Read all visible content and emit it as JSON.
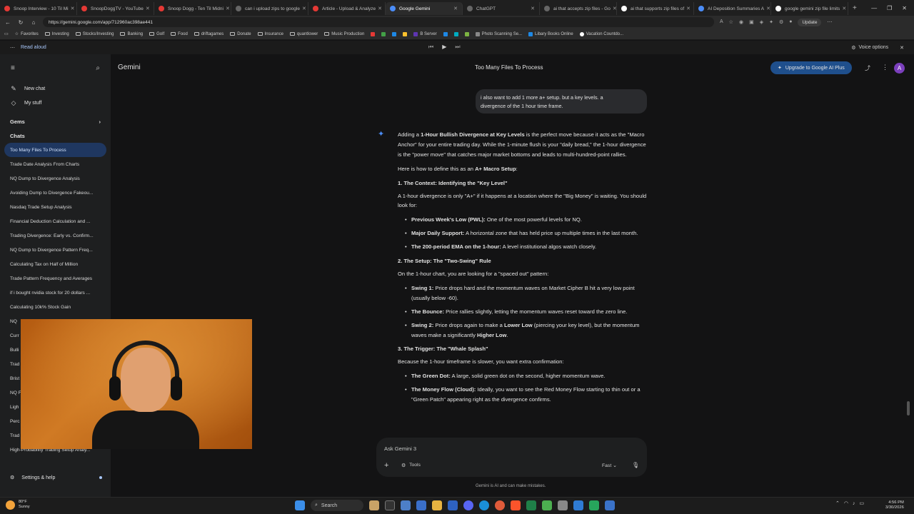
{
  "browser": {
    "tabs": [
      {
        "label": "Snoop Interview - 10 Til Mi",
        "icon_color": "#e53935"
      },
      {
        "label": "SnoopDoggTV - YouTube",
        "icon_color": "#e53935"
      },
      {
        "label": "Snoop Dogg - Ten Til Midni",
        "icon_color": "#e53935"
      },
      {
        "label": "can i upload zips to google",
        "icon_color": "#888888"
      },
      {
        "label": "Article - Upload & Analyze",
        "icon_color": "#e53935"
      },
      {
        "label": "Google Gemini",
        "icon_color": "#4b8df8"
      },
      {
        "label": "ChatGPT",
        "icon_color": "#888888"
      },
      {
        "label": "ai that accepts zip files - Go",
        "icon_color": "#888888"
      },
      {
        "label": "ai that supports zip files of",
        "icon_color": "#ffffff"
      },
      {
        "label": "AI Deposition Summaries A",
        "icon_color": "#4b8df8"
      },
      {
        "label": "google gemini zip file limits",
        "icon_color": "#ffffff"
      }
    ],
    "url": "https://gemini.google.com/app/712960ac398ae441",
    "update_label": "Update",
    "bookmarks": [
      {
        "label": "Favorites",
        "kind": "star-icon"
      },
      {
        "label": "Investing",
        "kind": "folder-icon"
      },
      {
        "label": "Stocks/Investing",
        "kind": "folder-icon"
      },
      {
        "label": "Banking",
        "kind": "folder-icon"
      },
      {
        "label": "Golf",
        "kind": "folder-icon"
      },
      {
        "label": "Food",
        "kind": "folder-icon"
      },
      {
        "label": "driftagames",
        "kind": "folder-icon"
      },
      {
        "label": "Donate",
        "kind": "folder-icon"
      },
      {
        "label": "Insurance",
        "kind": "folder-icon"
      },
      {
        "label": "quantlower",
        "kind": "folder-icon"
      },
      {
        "label": "Music Production",
        "kind": "folder-icon"
      },
      {
        "label": "B Server",
        "kind": "server-icon"
      },
      {
        "label": "Photo Scanning Se...",
        "kind": "site-icon"
      },
      {
        "label": "Libary Books Online",
        "kind": "site-icon"
      },
      {
        "label": "Vacation Countdo...",
        "kind": "site-icon"
      }
    ]
  },
  "read_aloud": {
    "label": "Read aloud",
    "voice_options": "Voice options"
  },
  "sidebar": {
    "new_chat": "New chat",
    "my_stuff": "My stuff",
    "gems": "Gems",
    "chats_heading": "Chats",
    "chats": [
      "Too Many Files To Process",
      "Trade Date Analysis From Charts",
      "NQ Dump to Divergence Analysis",
      "Avoiding Dump to Divergence Fakeou...",
      "Nasdaq Trade Setup Analysis",
      "Financial Deduction Calculation and ...",
      "Trading Divergence: Early vs. Confirm...",
      "NQ Dump to Divergence Pattern Freq...",
      "Calculating Tax on Half of Million",
      "Trade Pattern Frequency and Averages",
      "if i bought nvidia stock for 20 dollars ...",
      "Calculating 10k% Stock Gain",
      "NQ",
      "Curr",
      "Bulli",
      "Trad",
      "Brist",
      "NQ F",
      "Ligh",
      "Perc",
      "Trad",
      "High-Probability Trading Setup Analy..."
    ],
    "settings": "Settings & help"
  },
  "header": {
    "brand": "Gemini",
    "conversation_title": "Too Many Files To Process",
    "upgrade": "Upgrade to Google AI Plus",
    "avatar_letter": "A"
  },
  "user_message": {
    "line1": "i also want to add 1 more a+ setup. but a key levels. a",
    "line2": "divergence of the 1 hour time frame."
  },
  "response": {
    "intro_pre": "Adding a ",
    "intro_bold": "1-Hour Bullish Divergence at Key Levels",
    "intro_post": " is the perfect move because it acts as the \"Macro Anchor\" for your entire trading day. While the 1-minute flush is your \"daily bread,\" the 1-hour divergence is the \"power move\" that catches major market bottoms and leads to multi-hundred-point rallies.",
    "define_pre": "Here is how to define this as an ",
    "define_bold": "A+ Macro Setup",
    "define_post": ":",
    "s1_head": "1. The Context: Identifying the \"Key Level\"",
    "s1_body": "A 1-hour divergence is only \"A+\" if it happens at a location where the \"Big Money\" is waiting. You should look for:",
    "s1_items": [
      {
        "bold": "Previous Week's Low (PWL):",
        "text": " One of the most powerful levels for NQ."
      },
      {
        "bold": "Major Daily Support:",
        "text": " A horizontal zone that has held price up multiple times in the last month."
      },
      {
        "bold": "The 200-period EMA on the 1-hour:",
        "text": " A level institutional algos watch closely."
      }
    ],
    "s2_head": "2. The Setup: The \"Two-Swing\" Rule",
    "s2_body": "On the 1-hour chart, you are looking for a \"spaced out\" pattern:",
    "s2_i1_bold": "Swing 1:",
    "s2_i1_text": " Price drops hard and the momentum waves on Market Cipher B hit a very low point (usually below -60).",
    "s2_i2_bold": "The Bounce:",
    "s2_i2_text": " Price rallies slightly, letting the momentum waves reset toward the zero line.",
    "s2_i3_bold": "Swing 2:",
    "s2_i3_a": " Price drops again to make a ",
    "s2_i3_b": "Lower Low",
    "s2_i3_c": " (piercing your key level), but the momentum waves make a significantly ",
    "s2_i3_d": "Higher Low",
    "s2_i3_e": ".",
    "s3_head": "3. The Trigger: The \"Whale Splash\"",
    "s3_body": "Because the 1-hour timeframe is slower, you want extra confirmation:",
    "s3_i1_bold": "The Green Dot:",
    "s3_i1_text": " A large, solid green dot on the second, higher momentum wave.",
    "s3_i2_bold": "The Money Flow (Cloud):",
    "s3_i2_text": " Ideally, you want to see the Red Money Flow starting to thin out or a \"Green Patch\" appearing right as the divergence confirms."
  },
  "composer": {
    "placeholder": "Ask Gemini 3",
    "tools": "Tools",
    "mode": "Fast",
    "disclaimer": "Gemini is AI and can make mistakes."
  },
  "taskbar": {
    "temp": "80°F",
    "condition": "Sunny",
    "search": "Search",
    "time": "4:56 PM",
    "date": "3/30/2026"
  },
  "colors": {
    "accent": "#a8c7fa",
    "upgrade_bg": "#1f4f8c",
    "active_chat_bg": "#1f3760",
    "spark": "#4b8df8"
  }
}
